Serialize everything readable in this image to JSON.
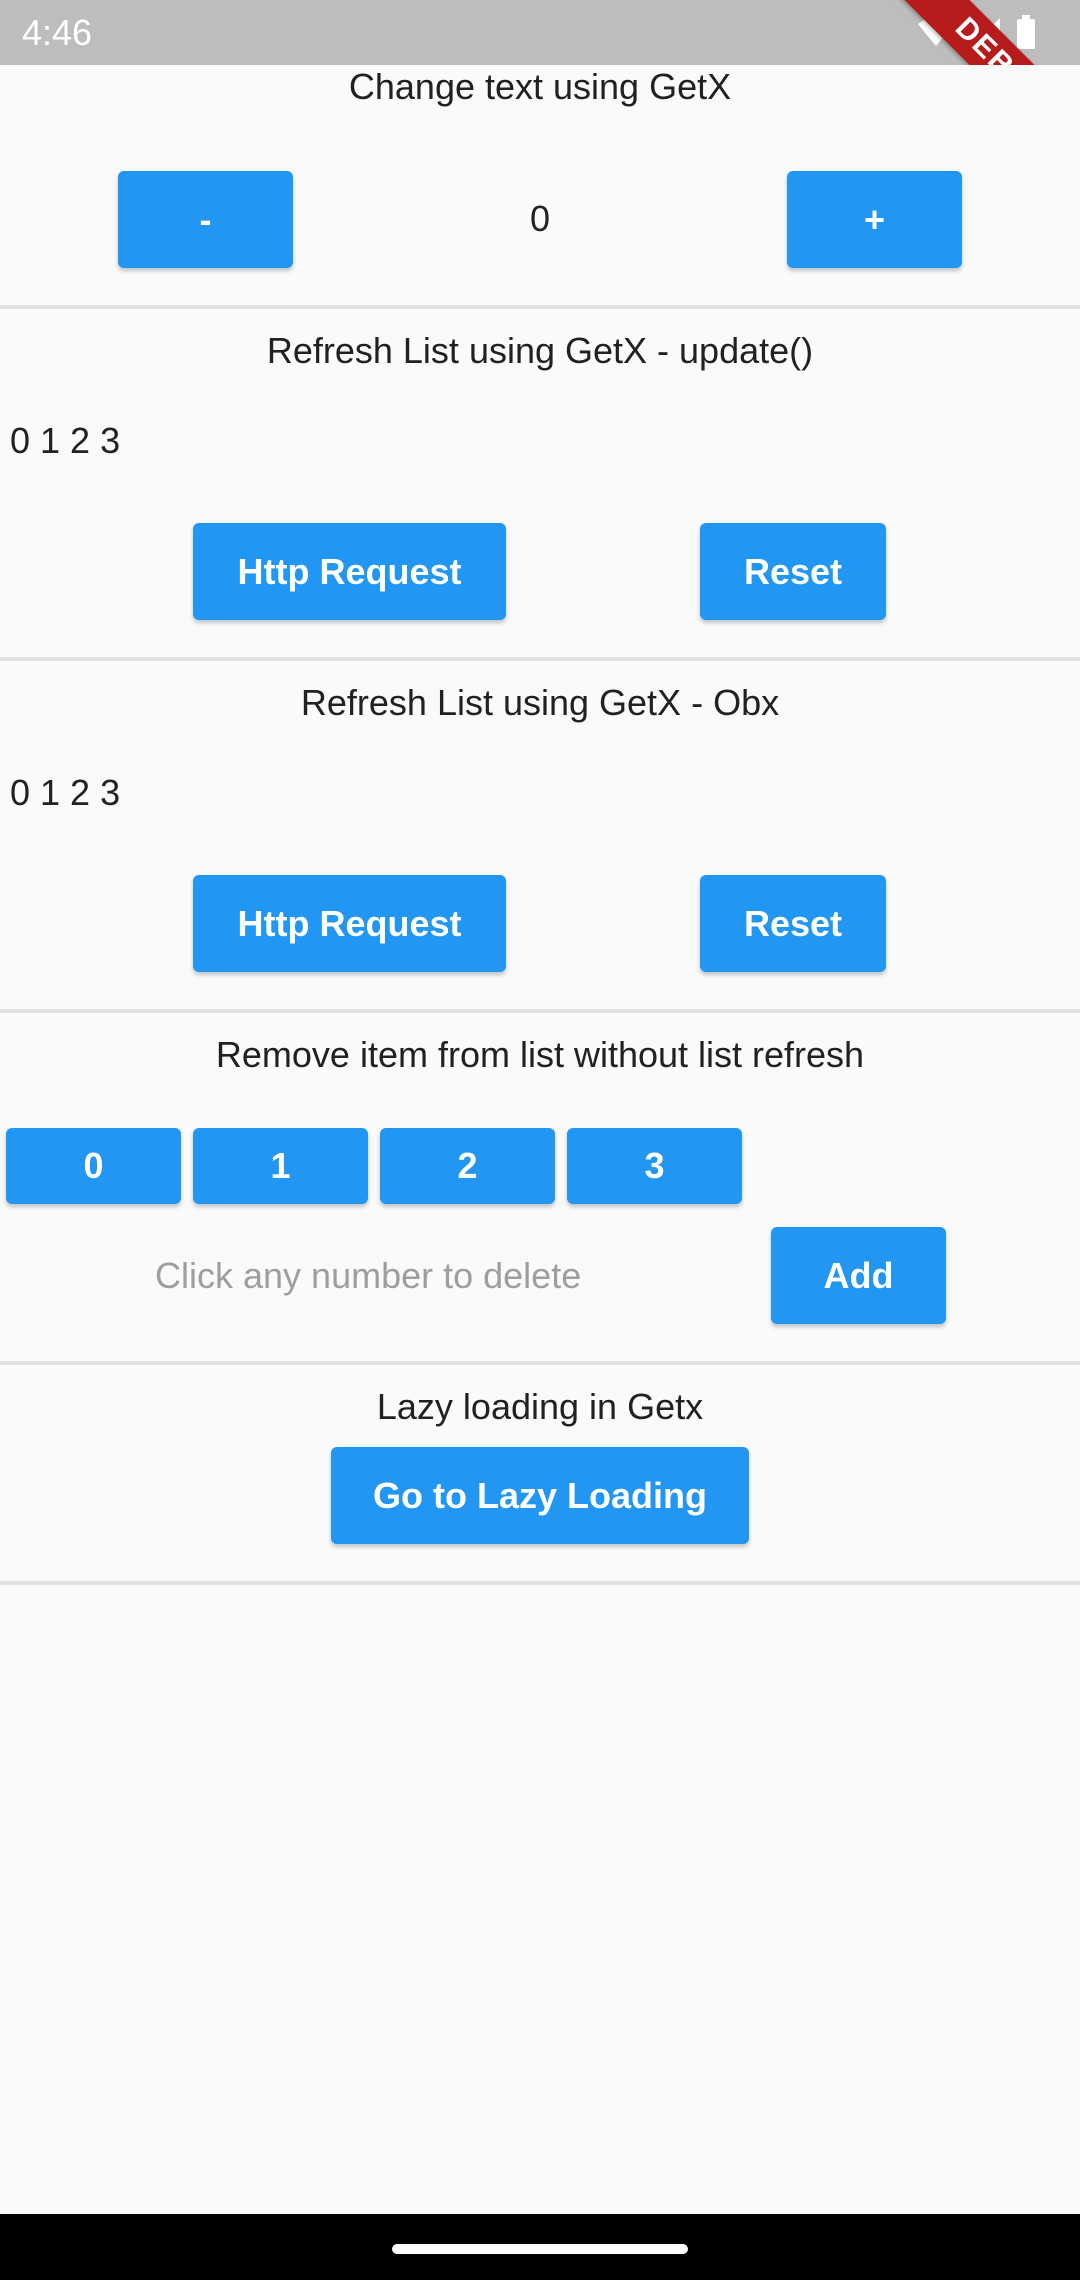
{
  "status_bar": {
    "time": "4:46",
    "icons": [
      "wifi-icon",
      "signal-icon",
      "battery-icon"
    ],
    "debug_ribbon": "DEBUG"
  },
  "section_change_text": {
    "title": "Change text using GetX",
    "minus_label": "-",
    "counter_value": "0",
    "plus_label": "+"
  },
  "section_update": {
    "title": "Refresh List using GetX - update()",
    "list_text": "0 1 2 3",
    "http_label": "Http Request",
    "reset_label": "Reset"
  },
  "section_obx": {
    "title": "Refresh List using GetX - Obx",
    "list_text": "0 1 2 3",
    "http_label": "Http Request",
    "reset_label": "Reset"
  },
  "section_remove": {
    "title": "Remove item from list without list refresh",
    "items": [
      "0",
      "1",
      "2",
      "3"
    ],
    "hint": "Click any number to delete",
    "add_label": "Add"
  },
  "section_lazy": {
    "title": "Lazy loading in Getx",
    "button_label": "Go to Lazy Loading"
  },
  "colors": {
    "primary": "#2196f3",
    "status_bar": "#bdbdbd",
    "debug_ribbon": "#b71c1c",
    "background": "#fafafa",
    "hint": "#9e9e9e"
  }
}
